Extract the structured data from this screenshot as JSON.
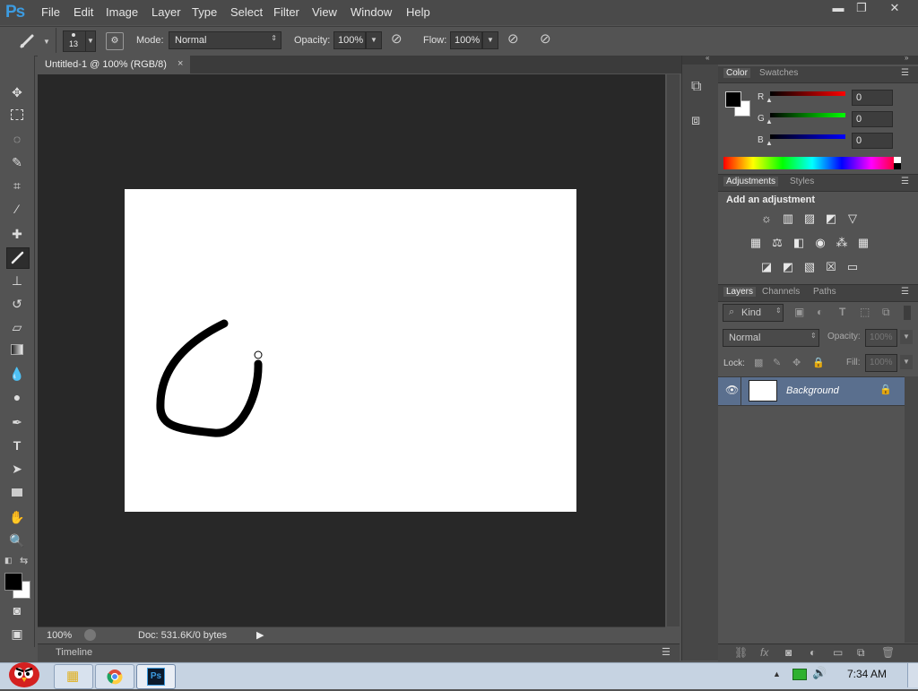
{
  "app": {
    "logo": "Ps"
  },
  "menu": [
    "File",
    "Edit",
    "Image",
    "Layer",
    "Type",
    "Select",
    "Filter",
    "View",
    "Window",
    "Help"
  ],
  "window_controls": {
    "minimize": "▬",
    "restore": "❐",
    "close": "✕"
  },
  "options": {
    "brush_size": "13",
    "mode_label": "Mode:",
    "mode_value": "Normal",
    "opacity_label": "Opacity:",
    "opacity_value": "100%",
    "flow_label": "Flow:",
    "flow_value": "100%"
  },
  "document": {
    "tab_title": "Untitled-1 @ 100% (RGB/8)",
    "tab_close": "×"
  },
  "status": {
    "zoom": "100%",
    "doc_info": "Doc: 531.6K/0 bytes"
  },
  "timeline": {
    "label": "Timeline"
  },
  "color_panel": {
    "tabs": [
      "Color",
      "Swatches"
    ],
    "channels": [
      {
        "label": "R",
        "value": "0"
      },
      {
        "label": "G",
        "value": "0"
      },
      {
        "label": "B",
        "value": "0"
      }
    ]
  },
  "adjustments_panel": {
    "tabs": [
      "Adjustments",
      "Styles"
    ],
    "heading": "Add an adjustment"
  },
  "layers_panel": {
    "tabs": [
      "Layers",
      "Channels",
      "Paths"
    ],
    "filter_kind": "Kind",
    "blend_mode": "Normal",
    "opacity_label": "Opacity:",
    "opacity_value": "100%",
    "lock_label": "Lock:",
    "fill_label": "Fill:",
    "fill_value": "100%",
    "layers": [
      {
        "name": "Background",
        "visible": true,
        "locked": true
      }
    ]
  },
  "taskbar": {
    "time": "7:34 AM"
  },
  "colors": {
    "foreground": "#000000",
    "background": "#ffffff",
    "ps_blue": "#3c9be0",
    "layer_selected": "#5a6f8e"
  }
}
